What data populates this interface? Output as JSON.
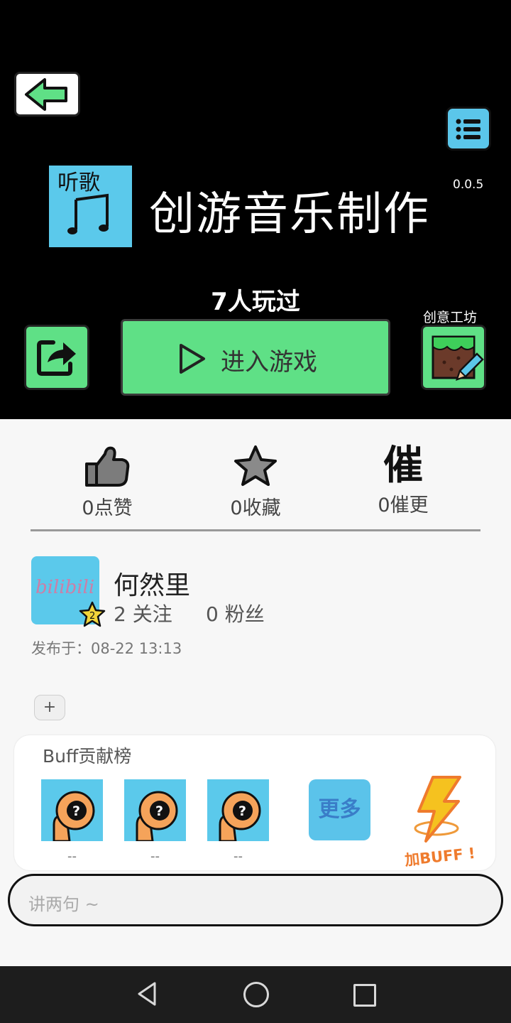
{
  "app": {
    "title": "创游音乐制作",
    "version": "0.0.5",
    "icon_text": "听歌",
    "played": "7人玩过"
  },
  "actions": {
    "enter_label": "进入游戏",
    "workshop_label": "创意工坊"
  },
  "stats": {
    "likes": "0点赞",
    "favorites": "0收藏",
    "urge_glyph": "催",
    "urges": "0催更"
  },
  "author": {
    "name": "何然里",
    "level": "2",
    "avatar_text": "bilibili 何",
    "following": "2 关注",
    "fans": "0 粉丝",
    "published": "发布于：08-22 13:13"
  },
  "add_label": "+",
  "buff": {
    "title": "Buff贡献榜",
    "contributors": [
      {
        "name": "--"
      },
      {
        "name": "--"
      },
      {
        "name": "--"
      }
    ],
    "more_label": "更多",
    "add_label": "加BUFF !"
  },
  "comment": {
    "placeholder": "讲两句 ~"
  },
  "colors": {
    "accent_green": "#5fe086",
    "accent_blue": "#5bc6ea",
    "buff_orange": "#ef7b2d"
  },
  "icons": [
    "back-arrow-icon",
    "list-menu-icon",
    "share-icon",
    "play-icon",
    "workshop-pencil-icon",
    "thumbs-up-icon",
    "star-icon",
    "urge-icon",
    "level-star-icon",
    "unknown-user-icon",
    "lightning-icon",
    "nav-back-icon",
    "nav-home-icon",
    "nav-recent-icon"
  ]
}
